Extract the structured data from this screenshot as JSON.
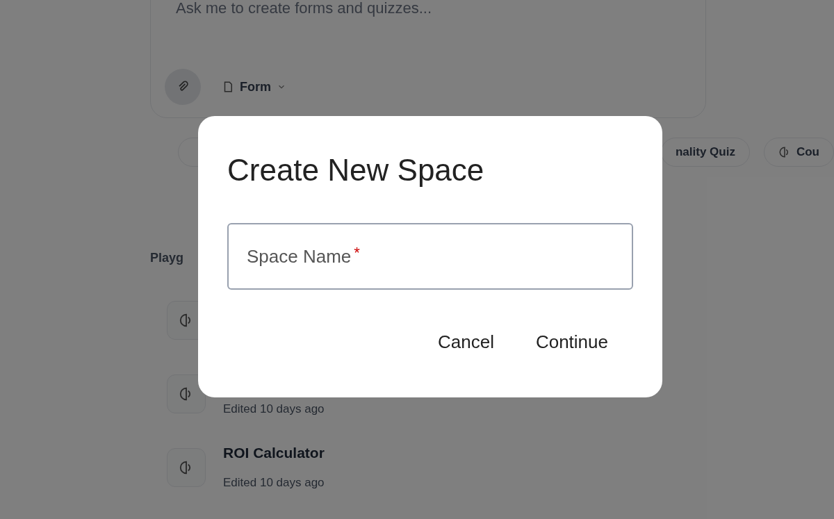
{
  "composer": {
    "placeholder": "Ask me to create forms and quizzes...",
    "mode": "Form"
  },
  "chips": [
    {
      "label": "nality Quiz"
    },
    {
      "label": "Cou"
    }
  ],
  "section": {
    "title": "Playg"
  },
  "items": [
    {
      "subtitle": "Edited 10 days ago"
    },
    {
      "title": "ROI Calculator",
      "subtitle": "Edited 10 days ago"
    }
  ],
  "dialog": {
    "title": "Create New Space",
    "field": {
      "label": "Space Name",
      "required": true,
      "marker": "*"
    },
    "buttons": [
      "Cancel",
      "Continue"
    ]
  }
}
